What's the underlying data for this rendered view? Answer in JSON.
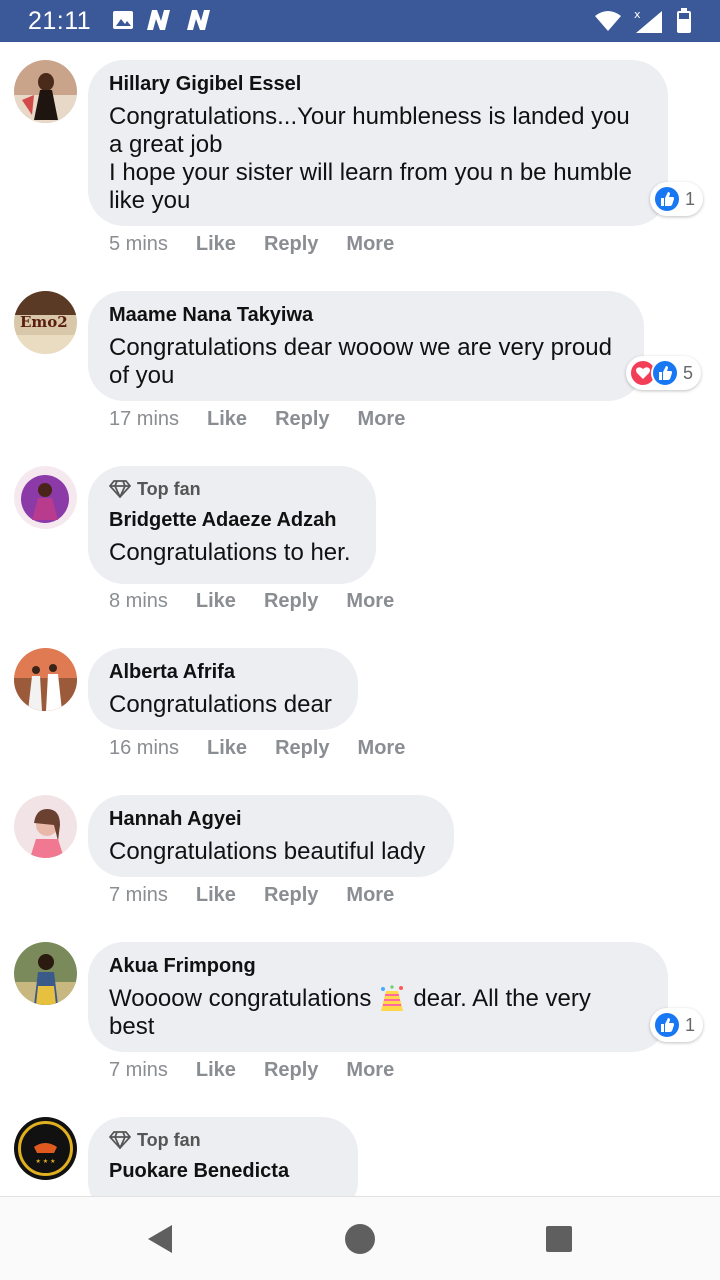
{
  "status_bar": {
    "time": "21:11",
    "left_icons": [
      "image-icon",
      "n-notification-icon",
      "n-notification-icon"
    ],
    "right_icons": [
      "wifi-icon",
      "signal-icon",
      "battery-icon"
    ],
    "background": "#3b5998"
  },
  "labels": {
    "like": "Like",
    "reply": "Reply",
    "more": "More",
    "top_fan": "Top fan"
  },
  "comments": [
    {
      "author": "Hillary Gigibel Essel",
      "text_lines": [
        "Congratulations...Your humbleness is landed you",
        "a great job",
        "I hope your sister will learn from you n be humble",
        "like you"
      ],
      "time": "5 mins",
      "reactions": {
        "icons": [
          "like-icon"
        ],
        "count": "1"
      }
    },
    {
      "author": "Maame Nana Takyiwa",
      "text_lines": [
        "Congratulations dear wooow we are very proud",
        "of you"
      ],
      "time": "17 mins",
      "reactions": {
        "icons": [
          "love-icon",
          "like-icon"
        ],
        "count": "5"
      }
    },
    {
      "top_fan": true,
      "author": "Bridgette Adaeze Adzah",
      "text_lines": [
        "Congratulations to her."
      ],
      "time": "8 mins"
    },
    {
      "author": "Alberta Afrifa",
      "text_lines": [
        "Congratulations dear"
      ],
      "time": "16 mins"
    },
    {
      "author": "Hannah Agyei",
      "text_lines": [
        "Congratulations beautiful lady"
      ],
      "time": "7 mins"
    },
    {
      "author": "Akua Frimpong",
      "text_lines": [
        "Woooow congratulations",
        "dear. All the very",
        "best"
      ],
      "emoji": "confetti-emoji",
      "time": "7 mins",
      "reactions": {
        "icons": [
          "like-icon"
        ],
        "count": "1"
      }
    },
    {
      "top_fan": true,
      "author": "Puokare Benedicta"
    }
  ],
  "nav_bar": {
    "buttons": [
      "back-icon",
      "home-icon",
      "recent-apps-icon"
    ]
  }
}
